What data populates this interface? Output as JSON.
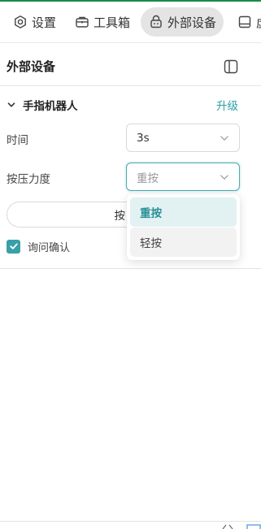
{
  "tabs": [
    {
      "label": "设置",
      "icon": "settings-icon"
    },
    {
      "label": "工具箱",
      "icon": "toolbox-icon"
    },
    {
      "label": "外部设备",
      "icon": "robot-icon",
      "active": true
    },
    {
      "label": "虚",
      "icon": "display-icon"
    }
  ],
  "panel": {
    "title": "外部设备",
    "toggle_icon": "sidebar-toggle-icon"
  },
  "section": {
    "title": "手指机器人",
    "upgrade_label": "升级",
    "time_label": "时间",
    "time_value": "3s",
    "pressure_label": "按压力度",
    "pressure_placeholder": "重按",
    "press_button_label": "按",
    "confirm_label": "询问确认",
    "confirm_checked": true
  },
  "dropdown": {
    "options": [
      "重按",
      "轻按"
    ],
    "selected": "重按"
  },
  "colors": {
    "accent": "#2a9fa9",
    "checkbox": "#3aa0a8",
    "active_tab_bg": "#e4e4e4",
    "top_line": "#1a8a4a"
  }
}
